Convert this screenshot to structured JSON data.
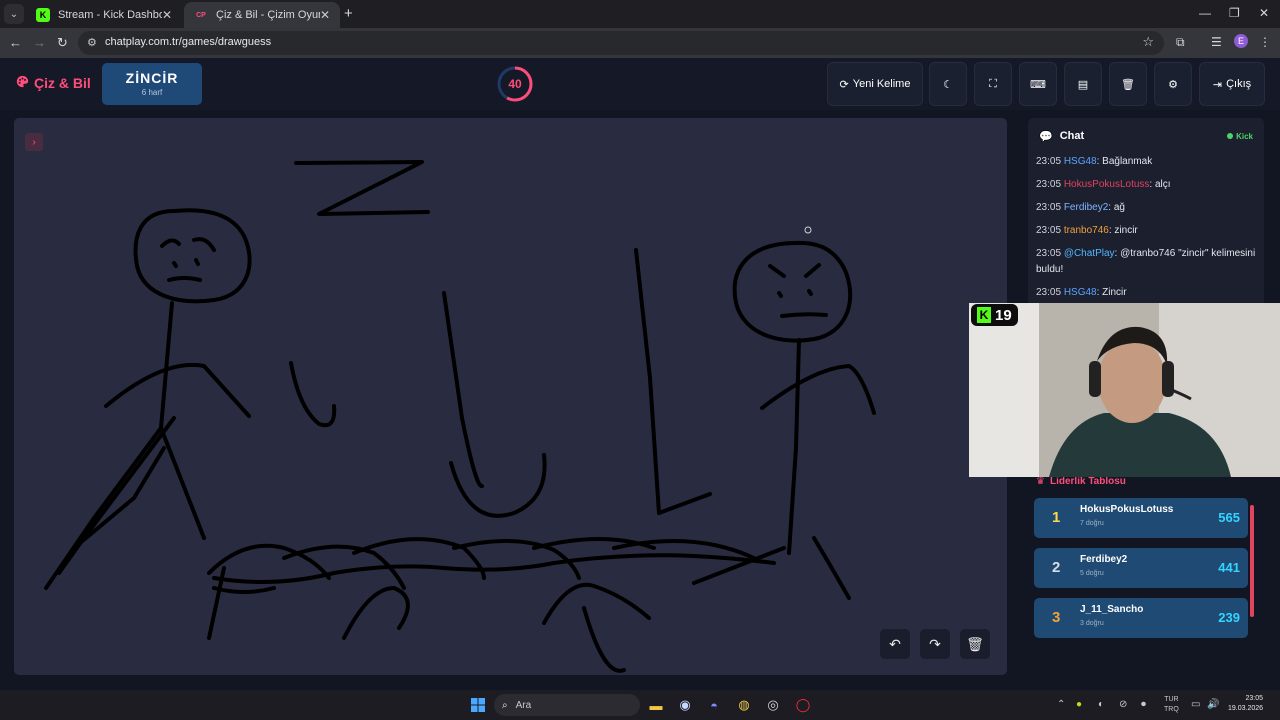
{
  "browser": {
    "tabs": [
      {
        "title": "Stream - Kick Dashboard",
        "favicon": "K"
      },
      {
        "title": "Çiz & Bil - Çizim Oyunu",
        "favicon": "CP"
      }
    ],
    "url": "chatplay.com.tr/games/drawguess"
  },
  "app": {
    "logo": "Çiz & Bil",
    "word": "ZİNCİR",
    "word_hint": "6 harf",
    "timer": "40",
    "timer_fraction": 0.58,
    "new_word_label": "Yeni Kelime",
    "exit_label": "Çıkış",
    "accent": "#ff4d7a"
  },
  "chat": {
    "title": "Chat",
    "platform": "Kick",
    "messages": [
      {
        "time": "23:05",
        "user": "HSG48",
        "color": "#5aa5ff",
        "text": ": Bağlanmak"
      },
      {
        "time": "23:05",
        "user": "HokusPokusLotuss",
        "color": "#e0445e",
        "text": ": alçı"
      },
      {
        "time": "23:05",
        "user": "Ferdibey2",
        "color": "#7fb5ff",
        "text": ": ağ"
      },
      {
        "time": "23:05",
        "user": "tranbo746",
        "color": "#f0a23c",
        "text": ": zincir"
      },
      {
        "time": "23:05",
        "user": "@ChatPlay",
        "color": "#55b6ff",
        "text": ": @tranbo746 \"zincir\" kelimesini buldu!"
      },
      {
        "time": "23:05",
        "user": "HSG48",
        "color": "#5aa5ff",
        "text": ": Zincir"
      }
    ]
  },
  "webcam": {
    "badge_count": "19"
  },
  "leaderboard": {
    "title": "Liderlik Tablosu",
    "rows": [
      {
        "rank": "1",
        "name": "HokusPokusLotuss",
        "correct": "7 doğru",
        "score": "565",
        "rank_color": "#ffd84a"
      },
      {
        "rank": "2",
        "name": "Ferdibey2",
        "correct": "5 doğru",
        "score": "441",
        "rank_color": "#d6dde6"
      },
      {
        "rank": "3",
        "name": "J_11_Sancho",
        "correct": "3 doğru",
        "score": "239",
        "rank_color": "#f0a23c"
      }
    ]
  },
  "taskbar": {
    "search_label": "Ara",
    "lang_top": "TUR",
    "lang_bottom": "TRQ",
    "time": "23:05",
    "date": "19.03.2026"
  }
}
